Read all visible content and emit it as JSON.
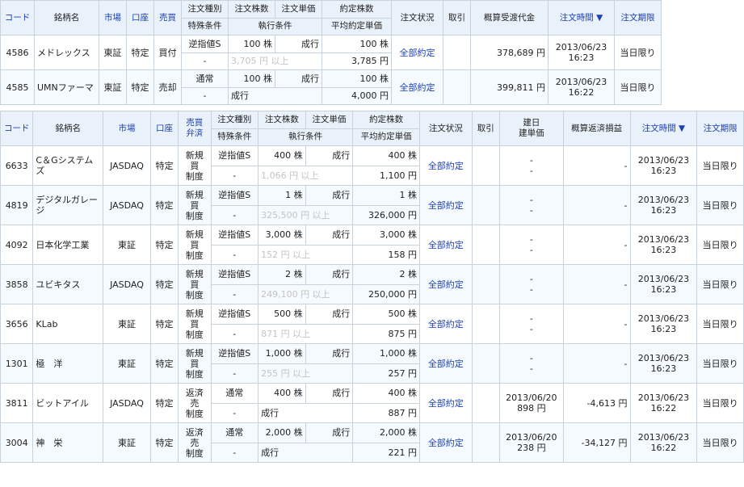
{
  "top_table": {
    "headers": {
      "code": "コード",
      "name": "銘柄名",
      "market": "市場",
      "account": "口座",
      "side": "売買",
      "order_type": "注文種別",
      "special": "特殊条件",
      "qty": "注文株数",
      "price": "注文単価",
      "exec_cond": "執行条件",
      "filled_qty": "約定株数",
      "avg_price": "平均約定単価",
      "status": "注文状況",
      "cancel": "取引",
      "est_amount": "概算受渡代金",
      "order_time": "注文時間 ▼",
      "expiry": "注文期限"
    },
    "rows": [
      {
        "code": "4586",
        "name": "メドレックス",
        "market": "東証",
        "account": "特定",
        "side": "買付",
        "order_type": "逆指値S",
        "special": "-",
        "qty": "100 株",
        "price": "成行",
        "exec_cond": "3,705 円 以上",
        "filled_qty": "100 株",
        "avg_price": "3,785 円",
        "status": "全部約定",
        "est_amount": "378,689 円",
        "date": "2013/06/23",
        "time": "16:23",
        "expiry": "当日限り"
      },
      {
        "code": "4585",
        "name": "UMNファーマ",
        "market": "東証",
        "account": "特定",
        "side": "売却",
        "order_type": "通常",
        "special": "-",
        "qty": "100 株",
        "price": "成行",
        "exec_cond": "成行",
        "filled_qty": "100 株",
        "avg_price": "4,000 円",
        "status": "全部約定",
        "est_amount": "399,811 円",
        "date": "2013/06/23",
        "time": "16:22",
        "expiry": "当日限り"
      }
    ]
  },
  "bottom_table": {
    "headers": {
      "code": "コード",
      "name": "銘柄名",
      "market": "市場",
      "account": "口座",
      "side_top": "売買",
      "side_bottom": "弁済",
      "order_type": "注文種別",
      "special": "特殊条件",
      "qty": "注文株数",
      "price": "注文単価",
      "exec_cond": "執行条件",
      "filled_qty": "約定株数",
      "avg_price": "平均約定単価",
      "status": "注文状況",
      "cancel": "取引",
      "open_date": "建日",
      "open_price": "建単価",
      "pl": "概算返済損益",
      "order_time": "注文時間 ▼",
      "expiry": "注文期限"
    },
    "rows": [
      {
        "code": "6633",
        "name": "C＆Gシステムズ",
        "market": "JASDAQ",
        "account": "特定",
        "side": [
          "新規",
          "買",
          "制度"
        ],
        "order_type": "逆指値S",
        "special": "-",
        "qty": "400 株",
        "price": "成行",
        "exec_cond": "1,066 円 以上",
        "filled_qty": "400 株",
        "avg_price": "1,100 円",
        "status": "全部約定",
        "open_date": "-",
        "open_price": "-",
        "pl": "-",
        "date": "2013/06/23",
        "time": "16:23",
        "expiry": "当日限り"
      },
      {
        "code": "4819",
        "name": "デジタルガレージ",
        "market": "JASDAQ",
        "account": "特定",
        "side": [
          "新規",
          "買",
          "制度"
        ],
        "order_type": "逆指値S",
        "special": "-",
        "qty": "1 株",
        "price": "成行",
        "exec_cond": "325,500 円 以上",
        "filled_qty": "1 株",
        "avg_price": "326,000 円",
        "status": "全部約定",
        "open_date": "-",
        "open_price": "-",
        "pl": "-",
        "date": "2013/06/23",
        "time": "16:23",
        "expiry": "当日限り"
      },
      {
        "code": "4092",
        "name": "日本化学工業",
        "market": "東証",
        "account": "特定",
        "side": [
          "新規",
          "買",
          "制度"
        ],
        "order_type": "逆指値S",
        "special": "-",
        "qty": "3,000 株",
        "price": "成行",
        "exec_cond": "152 円 以上",
        "filled_qty": "3,000 株",
        "avg_price": "158 円",
        "status": "全部約定",
        "open_date": "-",
        "open_price": "-",
        "pl": "-",
        "date": "2013/06/23",
        "time": "16:23",
        "expiry": "当日限り"
      },
      {
        "code": "3858",
        "name": "ユビキタス",
        "market": "JASDAQ",
        "account": "特定",
        "side": [
          "新規",
          "買",
          "制度"
        ],
        "order_type": "逆指値S",
        "special": "-",
        "qty": "2 株",
        "price": "成行",
        "exec_cond": "249,100 円 以上",
        "filled_qty": "2 株",
        "avg_price": "250,000 円",
        "status": "全部約定",
        "open_date": "-",
        "open_price": "-",
        "pl": "-",
        "date": "2013/06/23",
        "time": "16:23",
        "expiry": "当日限り"
      },
      {
        "code": "3656",
        "name": "KLab",
        "market": "東証",
        "account": "特定",
        "side": [
          "新規",
          "買",
          "制度"
        ],
        "order_type": "逆指値S",
        "special": "-",
        "qty": "500 株",
        "price": "成行",
        "exec_cond": "871 円 以上",
        "filled_qty": "500 株",
        "avg_price": "875 円",
        "status": "全部約定",
        "open_date": "-",
        "open_price": "-",
        "pl": "-",
        "date": "2013/06/23",
        "time": "16:23",
        "expiry": "当日限り"
      },
      {
        "code": "1301",
        "name": "極　洋",
        "market": "東証",
        "account": "特定",
        "side": [
          "新規",
          "買",
          "制度"
        ],
        "order_type": "逆指値S",
        "special": "-",
        "qty": "1,000 株",
        "price": "成行",
        "exec_cond": "255 円 以上",
        "filled_qty": "1,000 株",
        "avg_price": "257 円",
        "status": "全部約定",
        "open_date": "-",
        "open_price": "-",
        "pl": "-",
        "date": "2013/06/23",
        "time": "16:23",
        "expiry": "当日限り"
      },
      {
        "code": "3811",
        "name": "ビットアイル",
        "market": "JASDAQ",
        "account": "特定",
        "side": [
          "返済",
          "売",
          "制度"
        ],
        "order_type": "通常",
        "special": "-",
        "qty": "400 株",
        "price": "成行",
        "exec_cond": "成行",
        "filled_qty": "400 株",
        "avg_price": "887 円",
        "status": "全部約定",
        "open_date": "2013/06/20",
        "open_price": "898 円",
        "pl": "-4,613 円",
        "date": "2013/06/23",
        "time": "16:22",
        "expiry": "当日限り"
      },
      {
        "code": "3004",
        "name": "神　栄",
        "market": "東証",
        "account": "特定",
        "side": [
          "返済",
          "売",
          "制度"
        ],
        "order_type": "通常",
        "special": "-",
        "qty": "2,000 株",
        "price": "成行",
        "exec_cond": "成行",
        "filled_qty": "2,000 株",
        "avg_price": "221 円",
        "status": "全部約定",
        "open_date": "2013/06/20",
        "open_price": "238 円",
        "pl": "-34,127 円",
        "date": "2013/06/23",
        "time": "16:22",
        "expiry": "当日限り"
      }
    ]
  }
}
